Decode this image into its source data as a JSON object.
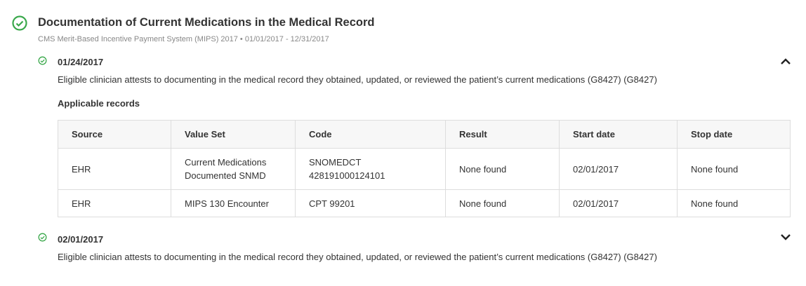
{
  "measure": {
    "title": "Documentation of Current Medications in the Medical Record",
    "subtitle": "CMS Merit-Based Incentive Payment System (MIPS) 2017 • 01/01/2017 - 12/31/2017",
    "status_color": "#3aa84b"
  },
  "encounters": [
    {
      "date": "01/24/2017",
      "description": "Eligible clinician attests to documenting in the medical record they obtained, updated, or reviewed the patient’s current medications (G8427) (G8427)",
      "expanded": true,
      "records_label": "Applicable records",
      "table": {
        "headers": [
          "Source",
          "Value Set",
          "Code",
          "Result",
          "Start date",
          "Stop date"
        ],
        "rows": [
          {
            "source": "EHR",
            "value_set_1": "Current Medications",
            "value_set_2": "Documented SNMD",
            "code_1": "SNOMEDCT",
            "code_2": "428191000124101",
            "result": "None found",
            "start": "02/01/2017",
            "stop": "None found"
          },
          {
            "source": "EHR",
            "value_set_1": "MIPS 130 Encounter",
            "code_1": "CPT 99201",
            "result": "None found",
            "start": "02/01/2017",
            "stop": "None found"
          }
        ]
      }
    },
    {
      "date": "02/01/2017",
      "description": "Eligible clinician attests to documenting in the medical record they obtained, updated, or reviewed the patient’s current medications (G8427) (G8427)",
      "expanded": false
    }
  ]
}
